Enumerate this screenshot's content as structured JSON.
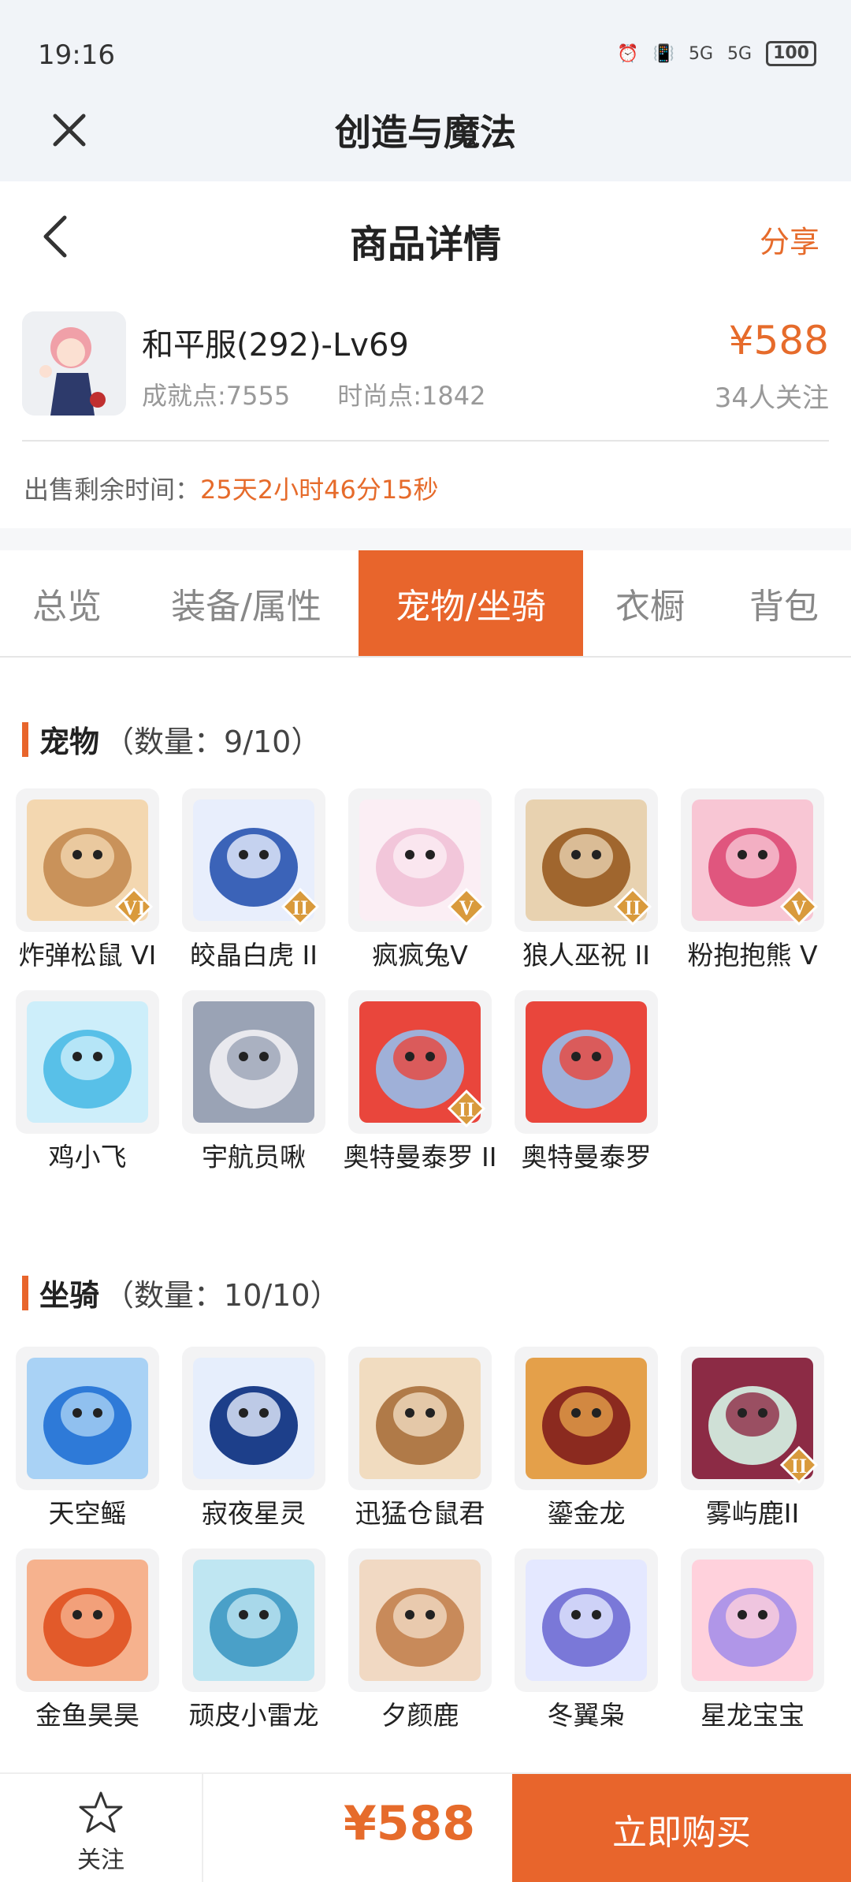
{
  "status": {
    "time": "19:16",
    "battery": "100",
    "signal1": "5G",
    "signal2": "5G"
  },
  "appbar": {
    "title": "创造与魔法"
  },
  "header": {
    "title": "商品详情",
    "share": "分享"
  },
  "product": {
    "name": "和平服(292)-Lv69",
    "achievement": "成就点:7555",
    "fashion": "时尚点:1842",
    "price": "¥588",
    "followers": "34人关注",
    "sale_label": "出售剩余时间：",
    "sale_time": "25天2小时46分15秒"
  },
  "tabs": [
    "总览",
    "装备/属性",
    "宠物/坐骑",
    "衣橱",
    "背包"
  ],
  "active_tab": 2,
  "pets": {
    "title": "宠物",
    "count": "（数量：9/10）",
    "items": [
      {
        "name": "炸弹松鼠 VI",
        "badge": "VI"
      },
      {
        "name": "皎晶白虎 II",
        "badge": "II"
      },
      {
        "name": "疯疯兔V",
        "badge": "V"
      },
      {
        "name": "狼人巫祝 II",
        "badge": "II"
      },
      {
        "name": "粉抱抱熊 V",
        "badge": "V"
      },
      {
        "name": "鸡小飞",
        "badge": ""
      },
      {
        "name": "宇航员啾",
        "badge": ""
      },
      {
        "name": "奥特曼泰罗 II",
        "badge": "II"
      },
      {
        "name": "奥特曼泰罗",
        "badge": ""
      }
    ]
  },
  "mounts": {
    "title": "坐骑",
    "count": "（数量：10/10）",
    "items": [
      {
        "name": "天空鳐",
        "badge": ""
      },
      {
        "name": "寂夜星灵",
        "badge": ""
      },
      {
        "name": "迅猛仓鼠君",
        "badge": ""
      },
      {
        "name": "鎏金龙",
        "badge": ""
      },
      {
        "name": "雾屿鹿II",
        "badge": "II"
      },
      {
        "name": "金鱼昊昊",
        "badge": ""
      },
      {
        "name": "顽皮小雷龙",
        "badge": ""
      },
      {
        "name": "夕颜鹿",
        "badge": ""
      },
      {
        "name": "冬翼枭",
        "badge": ""
      },
      {
        "name": "星龙宝宝",
        "badge": ""
      }
    ]
  },
  "bottom": {
    "follow": "关注",
    "price": "¥588",
    "buy": "立即购买"
  },
  "colors": {
    "accent": "#e8652c",
    "price": "#e66b2b"
  }
}
